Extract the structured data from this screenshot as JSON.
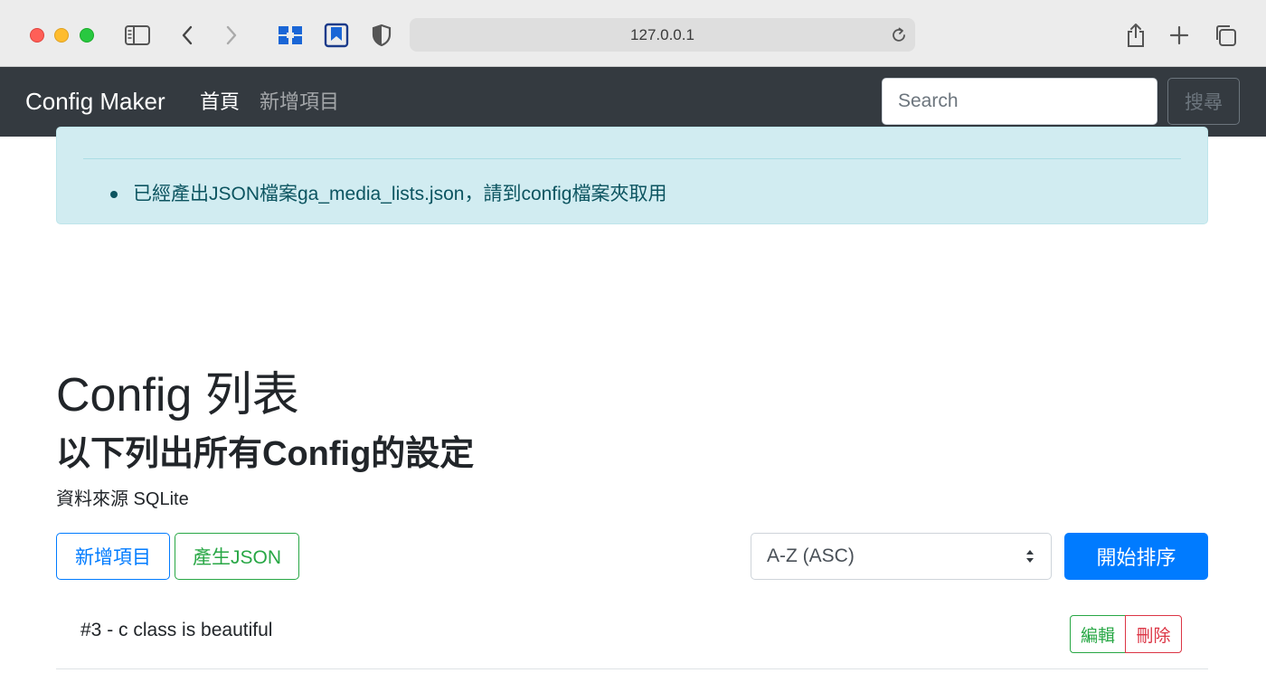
{
  "browser": {
    "address": "127.0.0.1"
  },
  "navbar": {
    "brand": "Config Maker",
    "home": "首頁",
    "add_item": "新增項目",
    "search_placeholder": "Search",
    "search_button": "搜尋"
  },
  "alert": {
    "message": "已經產出JSON檔案ga_media_lists.json，請到config檔案夾取用"
  },
  "main": {
    "title": "Config 列表",
    "subtitle": "以下列出所有Config的設定",
    "source": "資料來源 SQLite",
    "add_button": "新增項目",
    "json_button": "產生JSON",
    "sort_value": "A-Z (ASC)",
    "sort_button": "開始排序"
  },
  "list": {
    "items": [
      {
        "text": "#3 - c class is beautiful",
        "edit": "編輯",
        "delete": "刪除"
      }
    ]
  },
  "colors": {
    "primary": "#007bff",
    "success": "#28a745",
    "danger": "#dc3545",
    "navbar": "#343a40",
    "alert_bg": "#d1ecf1"
  }
}
